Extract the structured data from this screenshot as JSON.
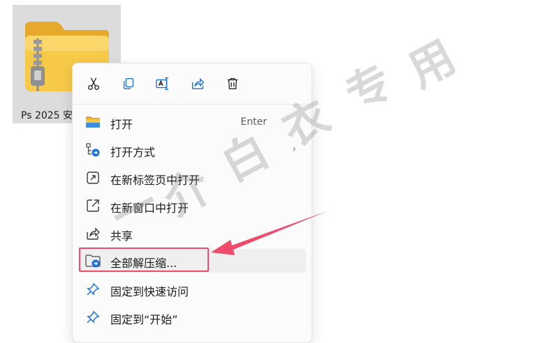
{
  "desktop": {
    "file": {
      "name": "Ps 2025 安装包",
      "icon": "zip-folder-icon"
    }
  },
  "context_menu": {
    "toolbar": [
      {
        "name": "cut",
        "icon": "scissors-icon"
      },
      {
        "name": "copy",
        "icon": "copy-icon"
      },
      {
        "name": "rename",
        "icon": "rename-icon"
      },
      {
        "name": "share",
        "icon": "share-icon"
      },
      {
        "name": "delete",
        "icon": "trash-icon"
      }
    ],
    "items": [
      {
        "label": "打开",
        "shortcut": "Enter",
        "icon": "folder-icon"
      },
      {
        "label": "打开方式",
        "submenu_arrow": "›",
        "icon": "open-with-icon"
      },
      {
        "label": "在新标签页中打开",
        "icon": "new-tab-icon"
      },
      {
        "label": "在新窗口中打开",
        "icon": "new-window-icon"
      },
      {
        "label": "共享",
        "icon": "share-icon"
      },
      {
        "label": "全部解压缩...",
        "icon": "extract-icon"
      },
      {
        "label": "固定到快速访问",
        "icon": "pin-icon"
      },
      {
        "label": "固定到“开始”",
        "icon": "pin-icon"
      }
    ]
  },
  "watermark": {
    "chars": [
      "一",
      "介",
      "白",
      "衣",
      "专",
      "用"
    ]
  },
  "colors": {
    "annotation": "#ef4b6a",
    "selection": "#dcdcdc",
    "hover": "#efefef",
    "folder": "#f5c242",
    "accent": "#1a6fd8"
  }
}
